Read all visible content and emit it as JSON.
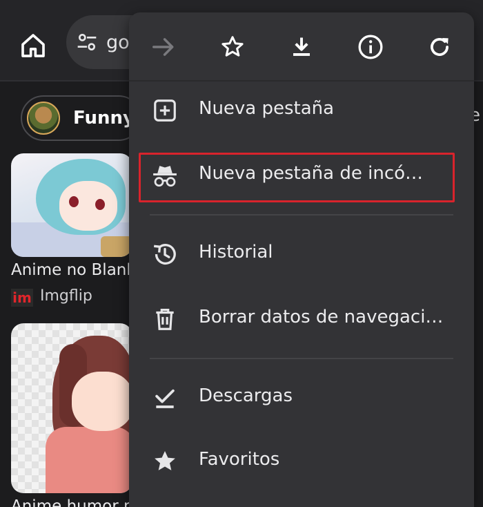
{
  "omnibox": {
    "text": "go"
  },
  "chips": [
    {
      "label": "Funny"
    }
  ],
  "feed": {
    "edge_text": "e",
    "items": [
      {
        "caption": "Anime no Blank",
        "source_icon": "im",
        "source": "Imgflip"
      },
      {
        "caption": "Anime humor m"
      }
    ]
  },
  "menu": {
    "icons": [
      "forward-icon",
      "bookmark-star-icon",
      "download-icon",
      "info-icon",
      "refresh-icon"
    ],
    "items": [
      {
        "label": "Nueva pestaña",
        "icon": "new-tab-icon"
      },
      {
        "label": "Nueva pestaña de incó…",
        "icon": "incognito-icon",
        "highlighted": true
      },
      {
        "label": "Historial",
        "icon": "history-icon"
      },
      {
        "label": "Borrar datos de navegaci…",
        "icon": "trash-icon"
      },
      {
        "label": "Descargas",
        "icon": "downloads-check-icon"
      },
      {
        "label": "Favoritos",
        "icon": "star-icon"
      }
    ]
  },
  "colors": {
    "highlight": "#d9232c",
    "menu_bg": "#333336",
    "page_bg": "#1c1c1e"
  }
}
